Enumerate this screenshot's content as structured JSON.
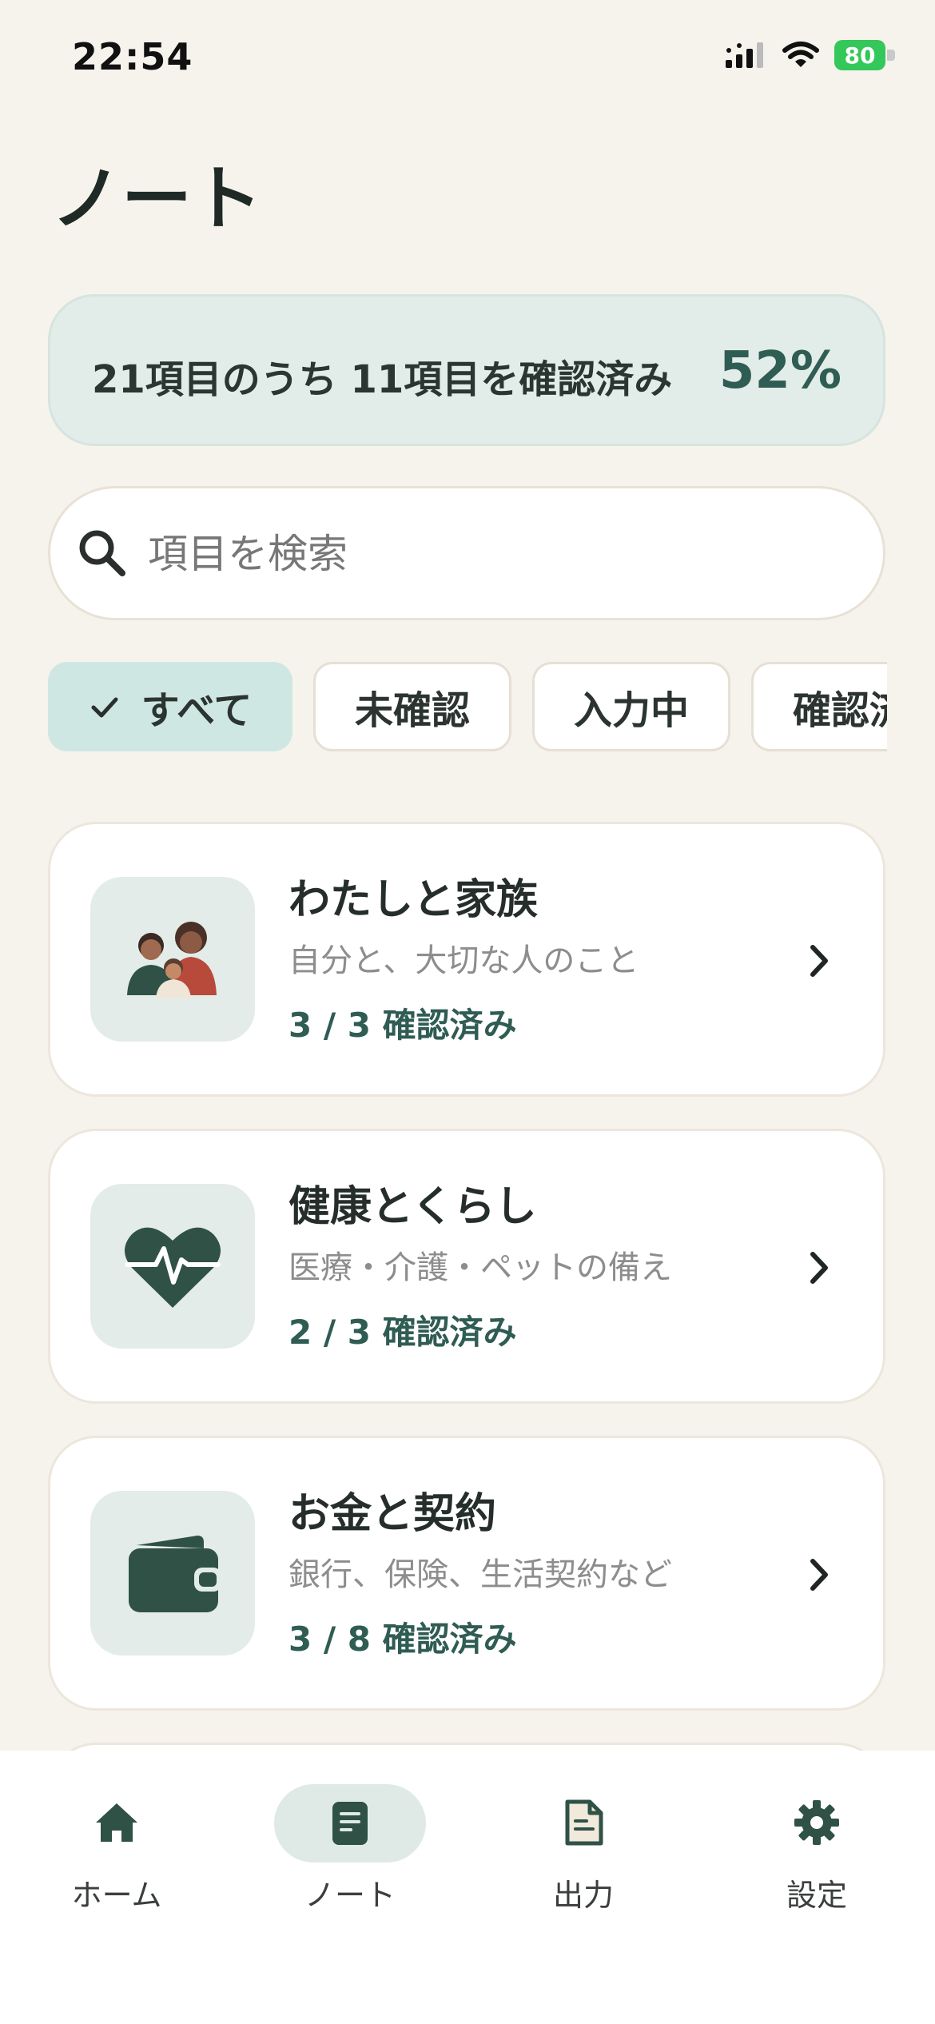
{
  "status_bar": {
    "time": "22:54",
    "battery": "80"
  },
  "page": {
    "title": "ノート"
  },
  "progress": {
    "text": "21項目のうち 11項目を確認済み",
    "percent": "52%"
  },
  "search": {
    "placeholder": "項目を検索",
    "value": ""
  },
  "filters": [
    {
      "label": "すべて",
      "selected": true
    },
    {
      "label": "未確認",
      "selected": false
    },
    {
      "label": "入力中",
      "selected": false
    },
    {
      "label": "確認済",
      "selected": false
    }
  ],
  "sections": [
    {
      "title": "わたしと家族",
      "subtitle": "自分と、大切な人のこと",
      "count": "3 / 3 確認済み",
      "icon": "family-icon"
    },
    {
      "title": "健康とくらし",
      "subtitle": "医療・介護・ペットの備え",
      "count": "2 / 3 確認済み",
      "icon": "heart-pulse-icon"
    },
    {
      "title": "お金と契約",
      "subtitle": "銀行、保険、生活契約など",
      "count": "3 / 8 確認済み",
      "icon": "wallet-icon"
    }
  ],
  "tabs": [
    {
      "label": "ホーム",
      "icon": "home-icon",
      "active": false
    },
    {
      "label": "ノート",
      "icon": "note-icon",
      "active": true
    },
    {
      "label": "出力",
      "icon": "document-icon",
      "active": false
    },
    {
      "label": "設定",
      "icon": "gear-icon",
      "active": false
    }
  ],
  "colors": {
    "background": "#f6f3ed",
    "accent": "#2f5c53",
    "accent_light": "#cfe7e2",
    "card": "#ffffff"
  }
}
